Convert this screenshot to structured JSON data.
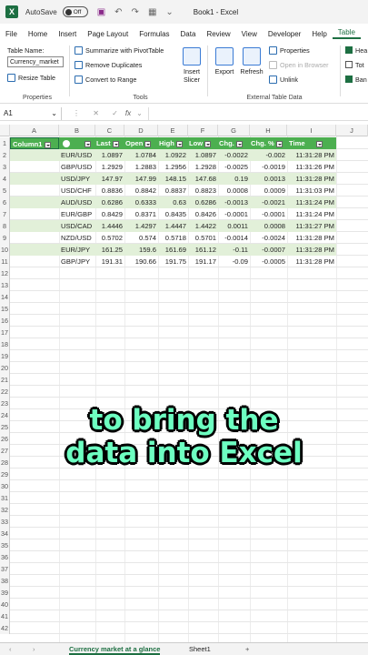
{
  "titlebar": {
    "autosave_label": "AutoSave",
    "toggle_state": "Off",
    "book_title": "Book1 - Excel"
  },
  "menu": [
    "File",
    "Home",
    "Insert",
    "Page Layout",
    "Formulas",
    "Data",
    "Review",
    "View",
    "Developer",
    "Help",
    "Table"
  ],
  "active_menu": "Table",
  "ribbon": {
    "properties": {
      "table_name_label": "Table Name:",
      "table_name_value": "Currency_market",
      "resize": "Resize Table",
      "group": "Properties"
    },
    "tools": {
      "summarize": "Summarize with PivotTable",
      "remove_dup": "Remove Duplicates",
      "convert": "Convert to Range",
      "slicer": "Insert Slicer",
      "group": "Tools"
    },
    "external": {
      "export": "Export",
      "refresh": "Refresh",
      "properties": "Properties",
      "open_browser": "Open in Browser",
      "unlink": "Unlink",
      "group": "External Table Data"
    },
    "style_options": {
      "header": "Hea",
      "total": "Tot",
      "banded": "Ban"
    }
  },
  "formula_bar": {
    "cell_ref": "A1",
    "fx": "fx"
  },
  "columns": [
    "A",
    "B",
    "C",
    "D",
    "E",
    "F",
    "G",
    "H",
    "I",
    "J"
  ],
  "table": {
    "headers": [
      "Column1",
      "",
      "Last",
      "Open",
      "High",
      "Low",
      "Chg.",
      "Chg. %",
      "Time"
    ],
    "rows": [
      [
        "EUR/USD",
        "1.0897",
        "1.0784",
        "1.0922",
        "1.0897",
        "-0.0022",
        "-0.002",
        "11:31:28 PM"
      ],
      [
        "GBP/USD",
        "1.2929",
        "1.2883",
        "1.2956",
        "1.2928",
        "-0.0025",
        "-0.0019",
        "11:31:26 PM"
      ],
      [
        "USD/JPY",
        "147.97",
        "147.99",
        "148.15",
        "147.68",
        "0.19",
        "0.0013",
        "11:31:28 PM"
      ],
      [
        "USD/CHF",
        "0.8836",
        "0.8842",
        "0.8837",
        "0.8823",
        "0.0008",
        "0.0009",
        "11:31:03 PM"
      ],
      [
        "AUD/USD",
        "0.6286",
        "0.6333",
        "0.63",
        "0.6286",
        "-0.0013",
        "-0.0021",
        "11:31:24 PM"
      ],
      [
        "EUR/GBP",
        "0.8429",
        "0.8371",
        "0.8435",
        "0.8426",
        "-0.0001",
        "-0.0001",
        "11:31:24 PM"
      ],
      [
        "USD/CAD",
        "1.4446",
        "1.4297",
        "1.4447",
        "1.4422",
        "0.0011",
        "0.0008",
        "11:31:27 PM"
      ],
      [
        "NZD/USD",
        "0.5702",
        "0.574",
        "0.5718",
        "0.5701",
        "-0.0014",
        "-0.0024",
        "11:31:28 PM"
      ],
      [
        "EUR/JPY",
        "161.25",
        "159.6",
        "161.69",
        "161.12",
        "-0.11",
        "-0.0007",
        "11:31:28 PM"
      ],
      [
        "GBP/JPY",
        "191.31",
        "190.66",
        "191.75",
        "191.17",
        "-0.09",
        "-0.0005",
        "11:31:28 PM"
      ]
    ]
  },
  "row_numbers": [
    "1",
    "2",
    "3",
    "4",
    "5",
    "6",
    "7",
    "8",
    "9",
    "10",
    "11",
    "12",
    "13",
    "14",
    "15",
    "16",
    "17",
    "18",
    "19",
    "20",
    "21",
    "22",
    "23",
    "24",
    "25",
    "26",
    "27",
    "28",
    "29",
    "30",
    "31",
    "32",
    "33",
    "34",
    "35",
    "36",
    "37",
    "38",
    "39",
    "40",
    "41",
    "42",
    "43"
  ],
  "caption": {
    "line1": "to bring the",
    "line2": "data into Excel"
  },
  "sheets": {
    "active": "Currency market at a glance",
    "other": "Sheet1",
    "add": "+"
  },
  "colors": {
    "header_green": "#4caf50",
    "band_green": "#e2f0d9",
    "caption": "#6dffc1"
  }
}
